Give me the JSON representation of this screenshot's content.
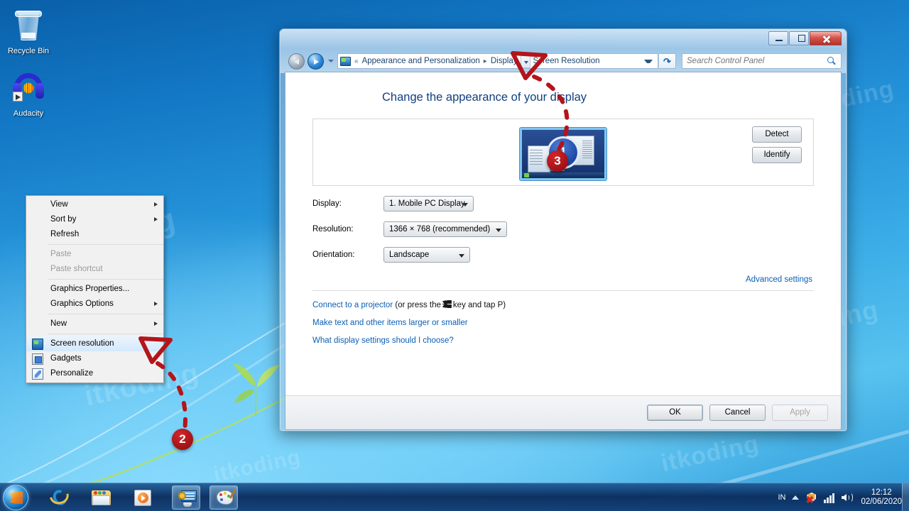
{
  "desktop": {
    "icons": [
      {
        "label": "Recycle Bin",
        "icon": "recycle-bin-icon"
      },
      {
        "label": "Audacity",
        "icon": "audacity-icon"
      }
    ],
    "watermark": "itkoding"
  },
  "context_menu": {
    "items": [
      {
        "label": "View",
        "submenu": true,
        "disabled": false,
        "selected": false,
        "icon": ""
      },
      {
        "label": "Sort by",
        "submenu": true,
        "disabled": false,
        "selected": false,
        "icon": ""
      },
      {
        "label": "Refresh",
        "submenu": false,
        "disabled": false,
        "selected": false,
        "icon": ""
      },
      {
        "separator": true
      },
      {
        "label": "Paste",
        "submenu": false,
        "disabled": true,
        "selected": false,
        "icon": ""
      },
      {
        "label": "Paste shortcut",
        "submenu": false,
        "disabled": true,
        "selected": false,
        "icon": ""
      },
      {
        "separator": true
      },
      {
        "label": "Graphics Properties...",
        "submenu": false,
        "disabled": false,
        "selected": false,
        "icon": ""
      },
      {
        "label": "Graphics Options",
        "submenu": true,
        "disabled": false,
        "selected": false,
        "icon": ""
      },
      {
        "separator": true
      },
      {
        "label": "New",
        "submenu": true,
        "disabled": false,
        "selected": false,
        "icon": ""
      },
      {
        "separator": true
      },
      {
        "label": "Screen resolution",
        "submenu": false,
        "disabled": false,
        "selected": true,
        "icon": "screen-resolution-icon"
      },
      {
        "label": "Gadgets",
        "submenu": false,
        "disabled": false,
        "selected": false,
        "icon": "gadgets-icon"
      },
      {
        "label": "Personalize",
        "submenu": false,
        "disabled": false,
        "selected": false,
        "icon": "personalize-icon"
      }
    ]
  },
  "window": {
    "title": "",
    "titlebar_buttons": {
      "minimize": "Minimize",
      "maximize": "Maximize",
      "close": "Close"
    },
    "nav": {
      "back": "Back",
      "forward": "Forward",
      "recent_pages": "Recent Pages",
      "refresh": "Refresh"
    },
    "breadcrumbs": [
      "Appearance and Personalization",
      "Display",
      "Screen Resolution"
    ],
    "search": {
      "placeholder": "Search Control Panel",
      "value": ""
    },
    "heading": "Change the appearance of your display",
    "preview": {
      "monitor_number": "1",
      "detect_label": "Detect",
      "identify_label": "Identify"
    },
    "fields": [
      {
        "label": "Display:",
        "value": "1. Mobile PC Display"
      },
      {
        "label": "Resolution:",
        "value": "1366 × 768 (recommended)"
      },
      {
        "label": "Orientation:",
        "value": "Landscape"
      }
    ],
    "advanced_settings": "Advanced settings",
    "links": {
      "projector_pre": "Connect to a projector",
      "projector_mid": "(or press the",
      "projector_post": "key and tap P)",
      "make_text": "Make text and other items larger or smaller",
      "what_settings": "What display settings should I choose?"
    },
    "buttons": {
      "ok": "OK",
      "cancel": "Cancel",
      "apply": "Apply",
      "apply_disabled": true
    }
  },
  "annotations": {
    "markers": [
      {
        "number": "2"
      },
      {
        "number": "3"
      }
    ],
    "color": "#b3151a"
  },
  "taskbar": {
    "start": "Start",
    "items": [
      {
        "name": "internet-explorer",
        "label": "Internet Explorer",
        "active": false
      },
      {
        "name": "windows-explorer",
        "label": "Windows Explorer",
        "active": false
      },
      {
        "name": "windows-media-player",
        "label": "Windows Media Player",
        "active": false
      },
      {
        "name": "screen-resolution",
        "label": "Screen Resolution",
        "active": true
      },
      {
        "name": "paint",
        "label": "Paint",
        "active": true
      }
    ],
    "tray": {
      "language": "IN",
      "show_hidden": "Show hidden icons",
      "action_center": "Action Center",
      "network": "Network",
      "volume": "Volume",
      "time": "12:12",
      "date": "02/06/2020"
    }
  }
}
